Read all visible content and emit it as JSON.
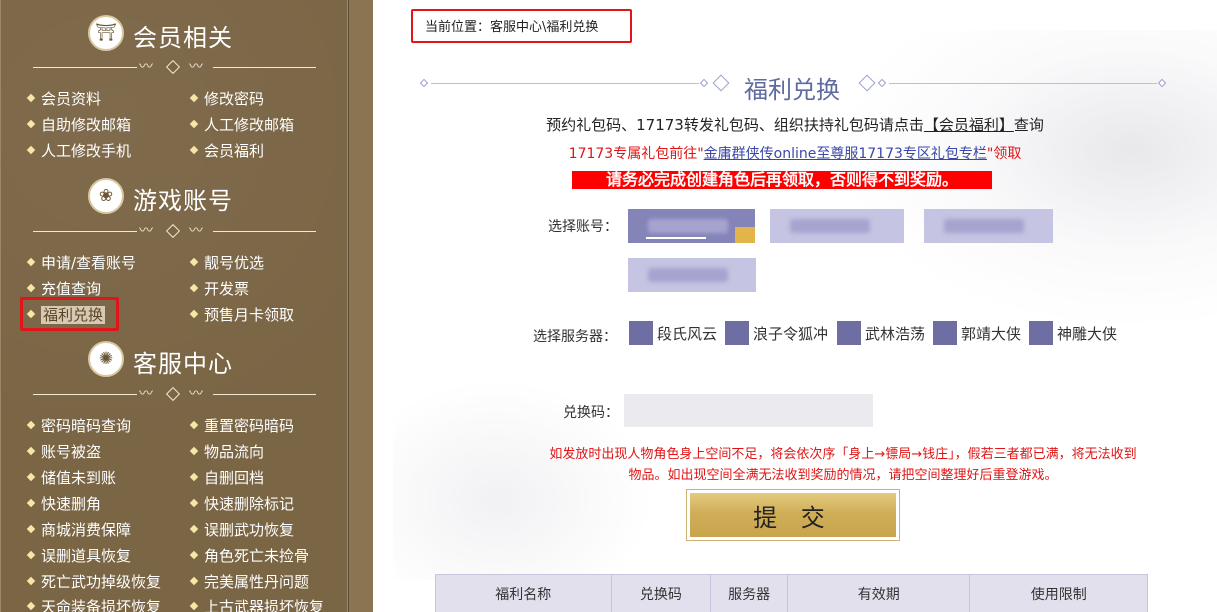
{
  "sidebar": {
    "sections": [
      {
        "title": "会员相关",
        "icon": "member-gate-icon",
        "glyph": "⛩"
      },
      {
        "title": "游戏账号",
        "icon": "game-lotus-icon",
        "glyph": "❀"
      },
      {
        "title": "客服中心",
        "icon": "service-sun-icon",
        "glyph": "✺"
      }
    ],
    "member_links": [
      "会员资料",
      "修改密码",
      "自助修改邮箱",
      "人工修改邮箱",
      "人工修改手机",
      "会员福利"
    ],
    "account_links": [
      "申请/查看账号",
      "靓号优选",
      "充值查询",
      "开发票",
      "福利兑换",
      "预售月卡领取"
    ],
    "service_links": [
      "密码暗码查询",
      "重置密码暗码",
      "账号被盗",
      "物品流向",
      "储值未到账",
      "自删回档",
      "快速删角",
      "快速删除标记",
      "商城消费保障",
      "误删武功恢复",
      "误删道具恢复",
      "角色死亡未捡骨",
      "死亡武功掉级恢复",
      "完美属性丹问题",
      "天命装备损坏恢复",
      "上古武器损坏恢复"
    ]
  },
  "main": {
    "breadcrumb": "当前位置：客服中心\\福利兑换",
    "title": "福利兑换",
    "info_prefix": "预约礼包码、17173转发礼包码、组织扶持礼包码请点击",
    "info_link": "【会员福利】",
    "info_suffix": "查询",
    "info2_prefix": "17173专属礼包前往\"",
    "info2_link": "金庸群侠传online至尊服17173专区礼包专栏",
    "info2_suffix": "\"领取",
    "warning": "请务必完成创建角色后再领取，否则得不到奖励。",
    "account_label": "选择账号：",
    "server_label": "选择服务器：",
    "servers": [
      "段氏风云",
      "浪子令狐冲",
      "武林浩荡",
      "郭靖大侠",
      "神雕大侠"
    ],
    "code_label": "兑换码：",
    "code_value": "",
    "notice": "如发放时出现人物角色身上空间不足，将会依次序「身上→镖局→钱庄」，假若三者都已满，将无法收到物品。如出现空间全满无法收到奖励的情况，请把空间整理好后重登游戏。",
    "submit": "提 交",
    "table_headers": [
      "福利名称",
      "兑换码",
      "服务器",
      "有效期",
      "使用限制"
    ]
  },
  "colors": {
    "sidebar_bg": "#7a6545",
    "highlight_red": "#e0151a",
    "accent_purple": "#6f6ea3",
    "submit_gold": "#d0ae58"
  }
}
